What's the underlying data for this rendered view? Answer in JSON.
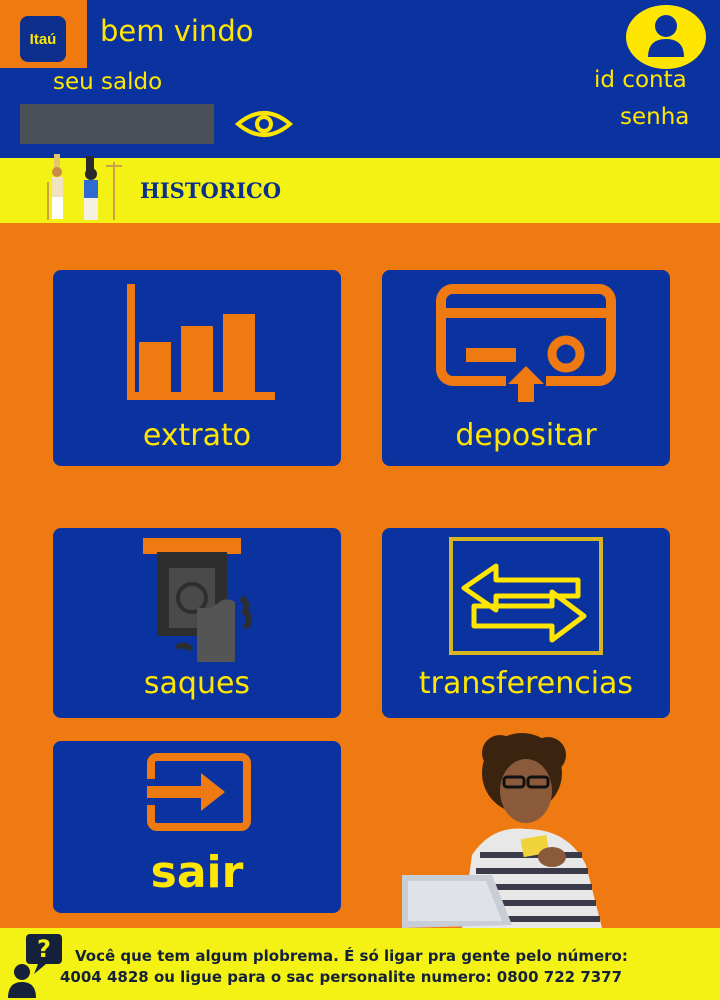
{
  "header": {
    "logo_text": "Itaú",
    "welcome": "bem vindo",
    "saldo_label": "seu saldo",
    "account_label": "id conta",
    "password_label": "senha"
  },
  "historico": {
    "label": "HISTORICO"
  },
  "tiles": {
    "extrato": "extrato",
    "depositar": "depositar",
    "saques": "saques",
    "transferencias": "transferencias",
    "sair": "sair"
  },
  "footer": {
    "line1": "Você que tem algum plobrema. É só ligar pra gente pelo número:",
    "line2": "4004 4828  ou ligue para o sac personalite numero: 0800 722 7377"
  },
  "colors": {
    "brand_blue": "#0b33a0",
    "brand_orange": "#ef7a12",
    "accent_yellow": "#ffe600",
    "bar_yellow": "#f4f214"
  },
  "icons": [
    "eye-icon",
    "user-icon",
    "bar-chart-icon",
    "card-deposit-icon",
    "cash-withdraw-icon",
    "transfer-arrows-icon",
    "exit-icon",
    "help-icon"
  ]
}
